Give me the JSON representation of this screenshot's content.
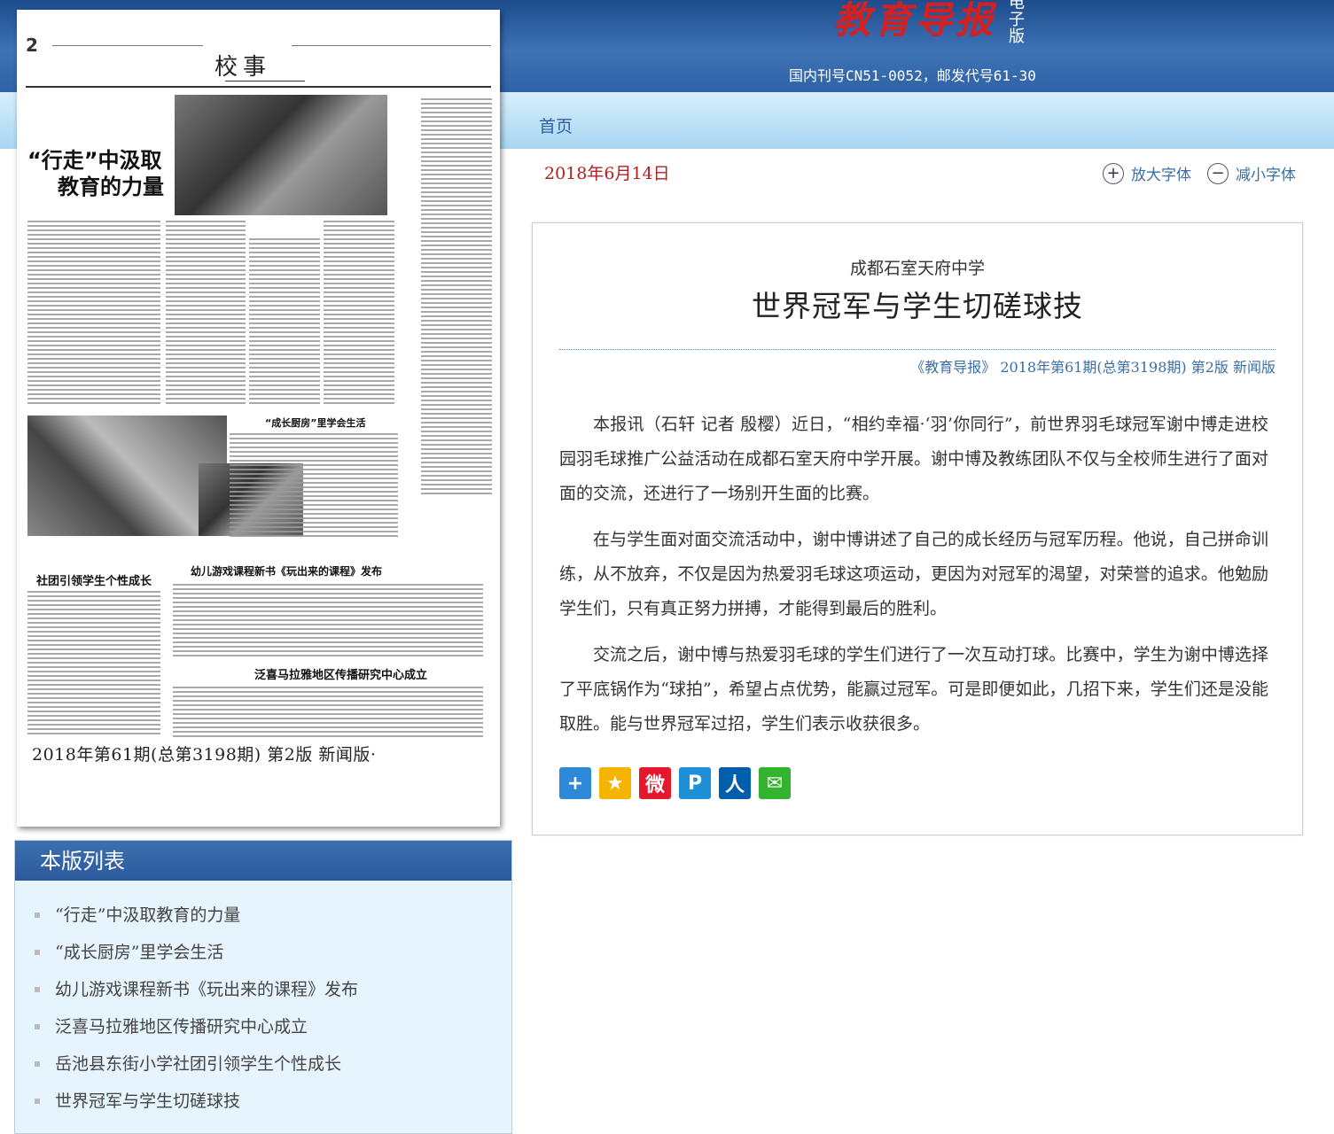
{
  "masthead": {
    "title": "教育导报",
    "edition_tag": "电子版",
    "issn_text": "国内刊号CN51-0052，邮发代号61-30"
  },
  "nav": {
    "home_label": "首页"
  },
  "paper": {
    "page_label": "校事",
    "headline_main": "“行走”中汲取",
    "headline_main_2": "教育的力量",
    "headline_kitchen": "“成长厨房”里学会生活",
    "headline_club": "社团引领学生个性成长",
    "headline_book": "幼儿游戏课程新书《玩出来的课程》发布",
    "headline_himalaya": "泛喜马拉雅地区传播研究中心成立",
    "caption": "2018年第61期(总第3198期)  第2版  新闻版·"
  },
  "page_list": {
    "title": "本版列表",
    "items": [
      "“行走”中汲取教育的力量",
      "“成长厨房”里学会生活",
      "幼儿游戏课程新书《玩出来的课程》发布",
      "泛喜马拉雅地区传播研究中心成立",
      "岳池县东街小学社团引领学生个性成长",
      "世界冠军与学生切磋球技"
    ]
  },
  "toolbar": {
    "date": "2018年6月14日",
    "enlarge_label": "放大字体",
    "shrink_label": "减小字体"
  },
  "article": {
    "kicker": "成都石室天府中学",
    "title": "世界冠军与学生切磋球技",
    "source": "《教育导报》 2018年第61期(总第3198期) 第2版 新闻版",
    "paragraphs": [
      "本报讯（石轩 记者 殷樱）近日，“相约幸福·‘羽’你同行”，前世界羽毛球冠军谢中博走进校园羽毛球推广公益活动在成都石室天府中学开展。谢中博及教练团队不仅与全校师生进行了面对面的交流，还进行了一场别开生面的比赛。",
      "在与学生面对面交流活动中，谢中博讲述了自己的成长经历与冠军历程。他说，自己拼命训练，从不放弃，不仅是因为热爱羽毛球这项运动，更因为对冠军的渴望，对荣誉的追求。他勉励学生们，只有真正努力拼搏，才能得到最后的胜利。",
      "交流之后，谢中博与热爱羽毛球的学生们进行了一次互动打球。比赛中，学生为谢中博选择了平底锅作为“球拍”，希望占点优势，能赢过冠军。可是即便如此，几招下来，学生们还是没能取胜。能与世界冠军过招，学生们表示收获很多。"
    ]
  },
  "share_icons": [
    {
      "name": "share-more-icon",
      "color": "#2e8ad8",
      "glyph": "+"
    },
    {
      "name": "qzone-icon",
      "color": "#f5b400",
      "glyph": "★"
    },
    {
      "name": "weibo-icon",
      "color": "#e6162d",
      "glyph": "微"
    },
    {
      "name": "tencent-weibo-icon",
      "color": "#1c8fd6",
      "glyph": "P"
    },
    {
      "name": "renren-icon",
      "color": "#005eac",
      "glyph": "人"
    },
    {
      "name": "wechat-icon",
      "color": "#33b32e",
      "glyph": "✉"
    }
  ]
}
